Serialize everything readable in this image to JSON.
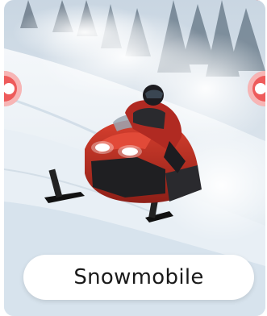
{
  "card": {
    "label": "Snowmobile",
    "image_icon": "snowmobile-image",
    "colors": {
      "accent": "#e53935",
      "nav_dot": "#ee5b5b",
      "pill_bg": "#ffffff",
      "text": "#1a1a1a"
    }
  },
  "nav": {
    "prev_icon": "prev-arrow-icon",
    "next_icon": "next-arrow-icon"
  }
}
